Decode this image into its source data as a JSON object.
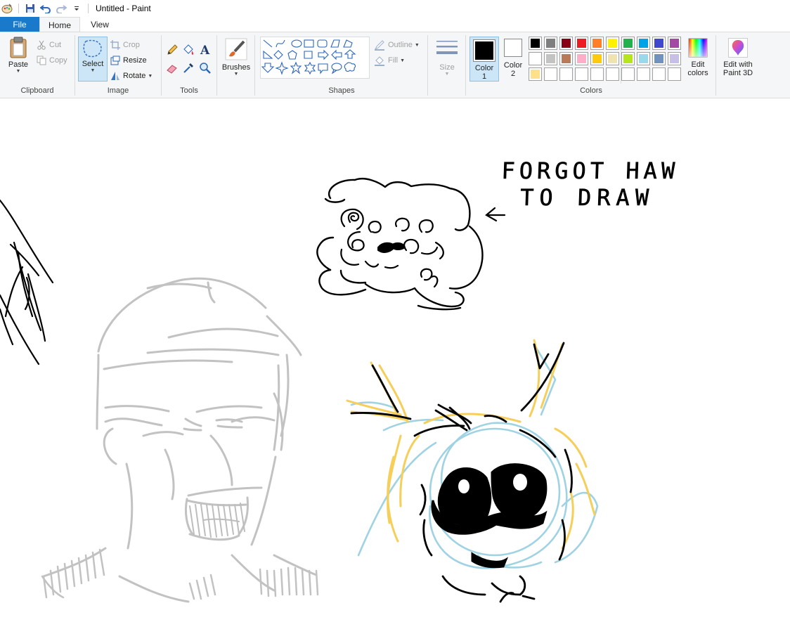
{
  "window": {
    "title": "Untitled - Paint"
  },
  "tabs": {
    "file": "File",
    "home": "Home",
    "view": "View"
  },
  "clipboard": {
    "paste": "Paste",
    "cut": "Cut",
    "copy": "Copy",
    "group_label": "Clipboard"
  },
  "image": {
    "select": "Select",
    "crop": "Crop",
    "resize": "Resize",
    "rotate": "Rotate",
    "group_label": "Image"
  },
  "tools": {
    "group_label": "Tools"
  },
  "brushes": {
    "label": "Brushes"
  },
  "shapes": {
    "outline": "Outline",
    "fill": "Fill",
    "group_label": "Shapes"
  },
  "size": {
    "label": "Size"
  },
  "colors": {
    "color1_line1": "Color",
    "color1_line2": "1",
    "color2_line1": "Color",
    "color2_line2": "2",
    "edit_colors_line1": "Edit",
    "edit_colors_line2": "colors",
    "edit_3d_line1": "Edit with",
    "edit_3d_line2": "Paint 3D",
    "group_label": "Colors",
    "color1_value": "#000000",
    "color2_value": "#ffffff",
    "palette_row1": [
      "#000000",
      "#7f7f7f",
      "#880015",
      "#ed1c24",
      "#ff7f27",
      "#fff200",
      "#22b14c",
      "#00a2e8",
      "#3f48cc",
      "#a349a4"
    ],
    "palette_row2": [
      "#ffffff",
      "#c3c3c3",
      "#b97a57",
      "#ffaec9",
      "#ffc90e",
      "#efe4b0",
      "#b5e61d",
      "#99d9ea",
      "#7092be",
      "#c8bfe7"
    ],
    "palette_row3": [
      "#ffe08a",
      "#ffffff",
      "#ffffff",
      "#ffffff",
      "#ffffff",
      "#ffffff",
      "#ffffff",
      "#ffffff",
      "#ffffff",
      "#ffffff"
    ]
  },
  "canvas": {
    "text_line1": "FORGOT  HAW",
    "text_line2": "TO  DRAW"
  }
}
